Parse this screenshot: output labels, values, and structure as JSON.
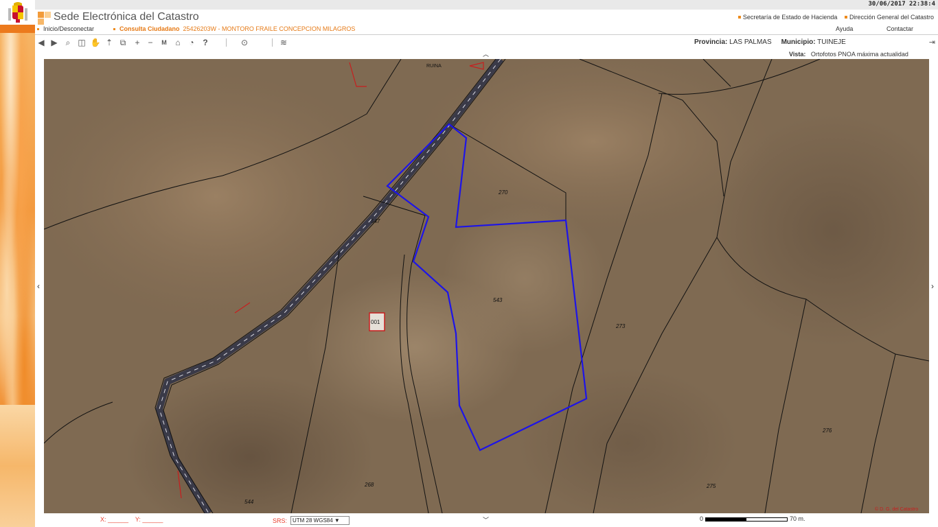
{
  "topbar": {
    "datetime": "30/06/2017  22:38:4"
  },
  "header": {
    "title": "Sede Electrónica del Catastro",
    "links_right": [
      "Secretaría de Estado de Hacienda",
      "Dirección General del Catastro"
    ],
    "nav_left": {
      "login": "Inicio/Desconectar",
      "consulta": "Consulta Ciudadano",
      "reference": "25426203W - MONTORO FRAILE CONCEPCION MILAGROS"
    },
    "nav_right": {
      "help": "Ayuda",
      "contact": "Contactar"
    }
  },
  "toolbar": {
    "tools": [
      "back-icon",
      "forward-icon",
      "search-icon",
      "cube-icon",
      "pan-hand-icon",
      "upload-icon",
      "layers-swap-icon",
      "zoom-in-icon",
      "zoom-out-icon",
      "measure-icon",
      "house-icon",
      "info-bubble-icon",
      "help-icon",
      "pin-icon",
      "layers-icon"
    ],
    "provincia_label": "Provincia:",
    "provincia_value": "LAS PALMAS",
    "municipio_label": "Municipio:",
    "municipio_value": "TUINEJE",
    "vista_label": "Vista:",
    "vista_value": "Ortofotos PNOA máxima actualidad"
  },
  "map": {
    "parcel_labels": [
      "270",
      "547",
      "543",
      "273",
      "276",
      "275",
      "268",
      "544",
      "001",
      "RUINA"
    ],
    "selected_parcel": "543",
    "highlight_color": "#1d14e8"
  },
  "bottombar": {
    "x_label": "X:",
    "y_label": "Y:",
    "srs_label": "SRS:",
    "srs_value": "UTM 28 WGS84 ▼",
    "scale_start": "0",
    "scale_end": "70 m."
  }
}
